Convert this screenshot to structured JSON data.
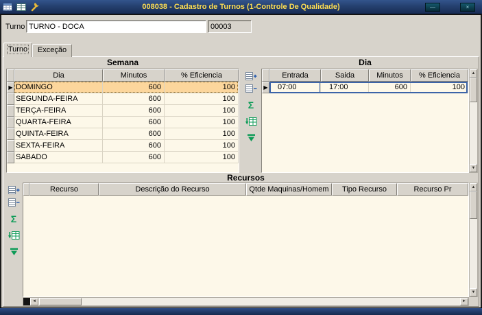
{
  "window": {
    "title": "008038 - Cadastro de Turnos (1-Controle De Qualidade)"
  },
  "form": {
    "turno_label": "Turno",
    "turno_value": "TURNO - DOCA",
    "turno_code": "00003"
  },
  "tabs": [
    {
      "label": "Turno"
    },
    {
      "label": "Exceção"
    }
  ],
  "semana": {
    "title": "Semana",
    "columns": [
      "Dia",
      "Minutos",
      "% Eficiencia"
    ],
    "rows": [
      {
        "dia": "DOMINGO",
        "minutos": "600",
        "eficiencia": "100"
      },
      {
        "dia": "SEGUNDA-FEIRA",
        "minutos": "600",
        "eficiencia": "100"
      },
      {
        "dia": "TERÇA-FEIRA",
        "minutos": "600",
        "eficiencia": "100"
      },
      {
        "dia": "QUARTA-FEIRA",
        "minutos": "600",
        "eficiencia": "100"
      },
      {
        "dia": "QUINTA-FEIRA",
        "minutos": "600",
        "eficiencia": "100"
      },
      {
        "dia": "SEXTA-FEIRA",
        "minutos": "600",
        "eficiencia": "100"
      },
      {
        "dia": "SABADO",
        "minutos": "600",
        "eficiencia": "100"
      }
    ]
  },
  "dia": {
    "title": "Dia",
    "columns": [
      "Entrada",
      "Saida",
      "Minutos",
      "% Eficiencia"
    ],
    "rows": [
      {
        "entrada": "07:00",
        "saida": "17:00",
        "minutos": "600",
        "eficiencia": "100"
      }
    ]
  },
  "recursos": {
    "title": "Recursos",
    "columns": [
      "Recurso",
      "Descrição do Recurso",
      "Qtde Maquinas/Homem",
      "Tipo Recurso",
      "Recurso Pr"
    ]
  },
  "icons": {
    "sigma": "Σ",
    "up": "▲",
    "down": "▼",
    "left": "◄",
    "right": "►",
    "row_marker": "▶",
    "minimize": "—",
    "close": "×"
  },
  "colors": {
    "titlebar_top": "#33548c",
    "titlebar_bottom": "#182c54",
    "title_text": "#ffdf52",
    "window_bg": "#d7d3cb",
    "cell_bg": "#fdf8e9",
    "selected_row_bg": "#fcd69c",
    "selection_border": "#3c64a8",
    "toolbar_green": "#0d9b57"
  }
}
